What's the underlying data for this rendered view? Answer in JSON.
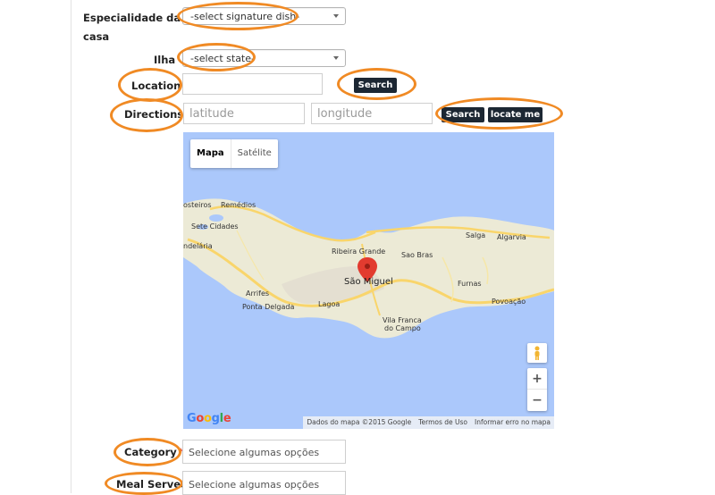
{
  "form": {
    "specialty_label_line1": "Especialidade da",
    "specialty_label_line2": "casa",
    "specialty_select": "-select signature dish-",
    "island_label": "Ilha",
    "island_select": "-select state-",
    "location_label": "Location",
    "location_value": "",
    "location_search": "Search",
    "directions_label": "Directions",
    "latitude_placeholder": "latitude",
    "longitude_placeholder": "longitude",
    "directions_search": "Search",
    "locate_me": "locate me",
    "category_label": "Category",
    "required_mark": "*",
    "category_placeholder": "Selecione algumas opções",
    "meal_label": "Meal Served",
    "meal_placeholder": "Selecione algumas opções"
  },
  "map": {
    "type_map": "Mapa",
    "type_satellite": "Satélite",
    "zoom_in": "+",
    "zoom_out": "−",
    "logo": "Google",
    "attribution": [
      "Dados do mapa ©2015 Google",
      "Termos de Uso",
      "Informar erro no mapa"
    ],
    "places": [
      "osteiros",
      "Remédios",
      "Sete Cidades",
      "ndelária",
      "Arrifes",
      "Ponta Delgada",
      "Lagoa",
      "Ribeira Grande",
      "São Miguel",
      "Sao Bras",
      "Salga",
      "Algarvia",
      "Furnas",
      "Vila Franca",
      "do Campo",
      "Povoação"
    ],
    "colors": {
      "sea": "#abc8fb",
      "land": "#ecead6",
      "road_major": "#f9d56b",
      "pin": "#e23b2f"
    }
  },
  "highlight_color": "#f08a24"
}
